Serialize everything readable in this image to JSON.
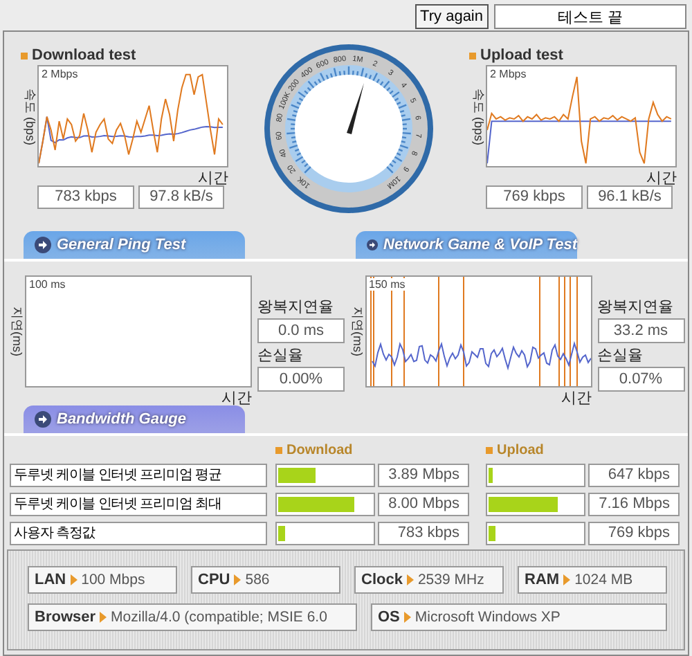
{
  "top_bar": {
    "button": "Try again",
    "status": "테스트 끝"
  },
  "download": {
    "title": "Download test",
    "y_axis": "속도 (bps)",
    "scale": "2 Mbps",
    "x_axis": "시간",
    "rate": "783 kbps",
    "throughput": "97.8 kB/s",
    "kind": "download"
  },
  "gauge": {
    "labels": [
      "10K",
      "20",
      "40",
      "60",
      "80",
      "100K",
      "200",
      "400",
      "600",
      "800",
      "1M",
      "2",
      "3",
      "4",
      "5",
      "6",
      "7",
      "8",
      "9",
      "10M"
    ]
  },
  "upload": {
    "title": "Upload test",
    "y_axis": "속도 (bps)",
    "scale": "2 Mbps",
    "x_axis": "시간",
    "rate": "769 kbps",
    "throughput": "96.1 kB/s",
    "kind": "upload"
  },
  "ping_tests": [
    {
      "header": "General Ping Test",
      "kind": "idle",
      "y_axis": "지연(ms)",
      "scale": "100 ms",
      "x_axis": "시간",
      "latency_label": "왕복지연율",
      "latency": "0.0 ms",
      "loss_label": "손실율",
      "loss": "0.00%"
    },
    {
      "header": "Network Game & VoIP Test",
      "kind": "trace",
      "y_axis": "지연(ms)",
      "scale": "150 ms",
      "x_axis": "시간",
      "latency_label": "왕복지연율",
      "latency": "33.2 ms",
      "loss_label": "손실율",
      "loss": "0.07%"
    }
  ],
  "bandwidth": {
    "header": "Bandwidth Gauge",
    "download_heading": "Download",
    "upload_heading": "Upload",
    "rows": [
      {
        "label": "두루넷 케이블 인터넷 프리미엄 평균",
        "download": {
          "level": 0.4,
          "value": "3.89 Mbps"
        },
        "upload": {
          "level": 0.04,
          "value": "647 kbps"
        }
      },
      {
        "label": "두루넷 케이블 인터넷 프리미엄 최대",
        "download": {
          "level": 0.81,
          "value": "8.00 Mbps"
        },
        "upload": {
          "level": 0.74,
          "value": "7.16 Mbps"
        }
      },
      {
        "label": "사용자 측정값",
        "download": {
          "level": 0.07,
          "value": "783 kbps"
        },
        "upload": {
          "level": 0.07,
          "value": "769 kbps"
        }
      }
    ]
  },
  "system_info": [
    [
      {
        "label": "LAN",
        "value": "100 Mbps"
      },
      {
        "label": "CPU",
        "value": "586"
      },
      {
        "label": "Clock",
        "value": "2539 MHz"
      },
      {
        "label": "RAM",
        "value": "1024 MB"
      }
    ],
    [
      {
        "label": "Browser",
        "value": "Mozilla/4.0 (compatible; MSIE 6.0"
      },
      {
        "label": "OS",
        "value": "Microsoft Windows XP"
      }
    ]
  ]
}
